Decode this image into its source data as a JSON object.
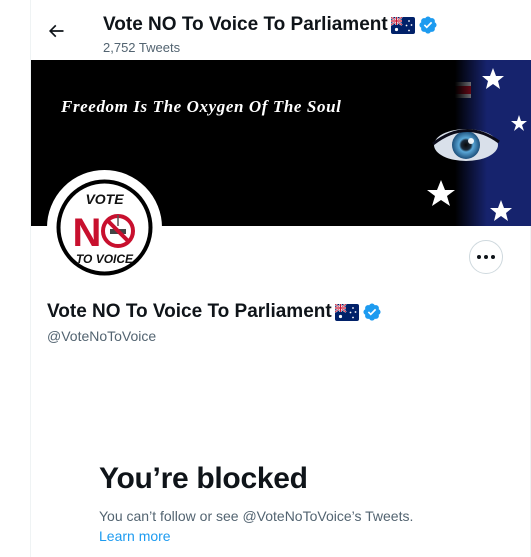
{
  "header": {
    "display_name": "Vote NO To Voice To Parliament",
    "tweet_count": "2,752 Tweets"
  },
  "banner": {
    "tagline": "Freedom Is The Oxygen Of The Soul"
  },
  "avatar": {
    "line_top": "VOTE",
    "letter_n": "N",
    "line_bottom": "TO VOICE"
  },
  "profile": {
    "display_name": "Vote NO To Voice To Parliament",
    "handle": "@VoteNoToVoice"
  },
  "blocked": {
    "title": "You’re blocked",
    "description": "You can’t follow or see @VoteNoToVoice’s Tweets.",
    "learn_more": "Learn more"
  },
  "colors": {
    "accent": "#1d9bf0",
    "text_primary": "#0f1419",
    "text_secondary": "#536471",
    "border": "#cfd9de",
    "avatar_red": "#c8102e",
    "flag_blue": "#012169"
  },
  "icons": {
    "back": "arrow-left-icon",
    "flag": "australia-flag-icon",
    "verified": "verified-badge-icon",
    "more": "more-horizontal-icon"
  }
}
